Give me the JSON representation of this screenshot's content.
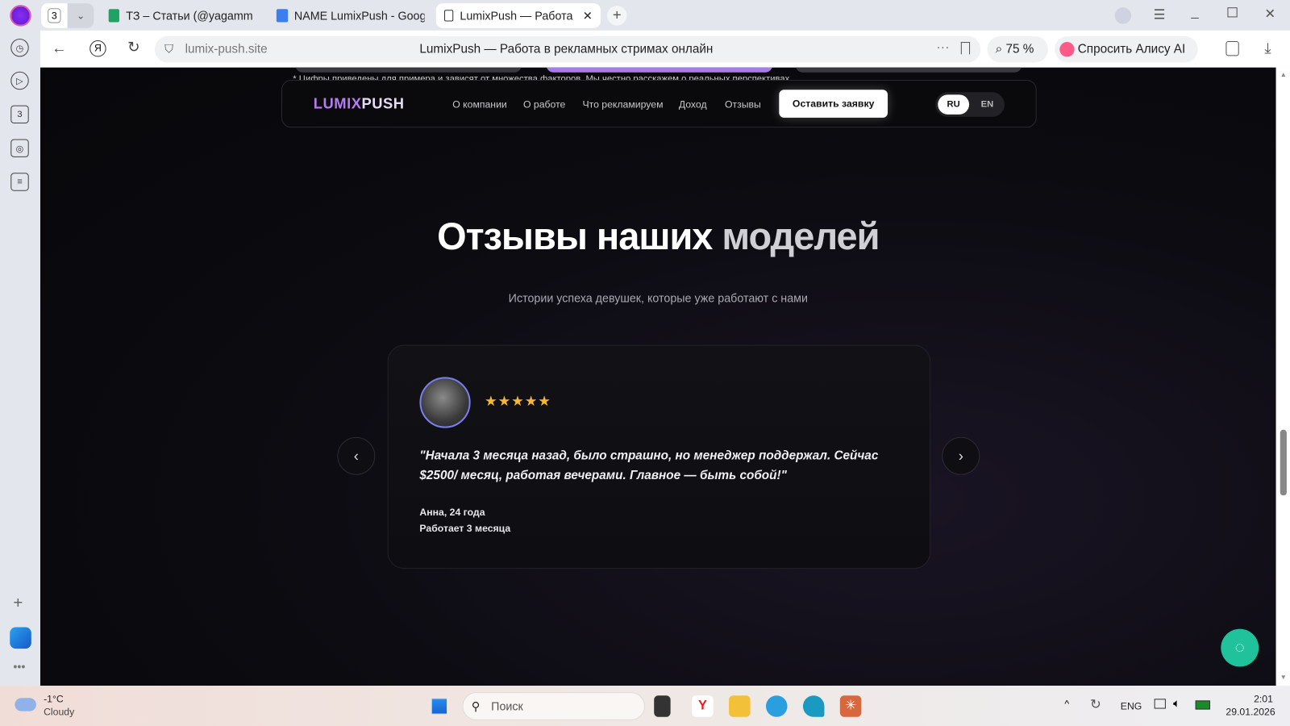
{
  "browser": {
    "tab_count": "3",
    "tabs": [
      {
        "label": "ТЗ – Статьи (@yagammii)"
      },
      {
        "label": "NAME LumixPush - Googl"
      },
      {
        "label": "LumixPush — Работа в"
      }
    ],
    "url": "lumix-push.site",
    "page_title": "LumixPush — Работа в рекламных стримах онлайн",
    "zoom": "75 %",
    "alice": "Спросить Алису AI",
    "sidebar_badge": "3"
  },
  "site": {
    "top_note": "* Цифры приведены для примера и зависят от множества факторов. Мы честно расскажем о реальных перспективах.",
    "logo": {
      "part1": "LUMIX",
      "part2": "PUSH"
    },
    "nav": [
      "О компании",
      "О работе",
      "Что рекламируем",
      "Доход",
      "Отзывы"
    ],
    "cta": "Оставить заявку",
    "lang": {
      "ru": "RU",
      "en": "EN",
      "active": "RU"
    },
    "section": {
      "title_main": "Отзывы наших ",
      "title_accent": "моделей",
      "subtitle": "Истории успеха девушек, которые уже работают с нами"
    },
    "review": {
      "rating": 5,
      "stars": "★★★★★",
      "quote": "\"Начала 3 месяца назад, было страшно, но менеджер поддержал. Сейчас $2500/ месяц, работая вечерами. Главное — быть собой!\"",
      "name": "Анна, 24 года",
      "tenure": "Работает 3 месяца"
    },
    "prev": "‹",
    "next": "›"
  },
  "taskbar": {
    "temp": "-1°C",
    "weather": "Cloudy",
    "search": "Поиск",
    "lang": "ENG",
    "time": "2:01",
    "date": "29.01.2026"
  },
  "colors": {
    "accent": "#b57cf0",
    "chat": "#1fc29a",
    "star": "#f5b82e"
  }
}
